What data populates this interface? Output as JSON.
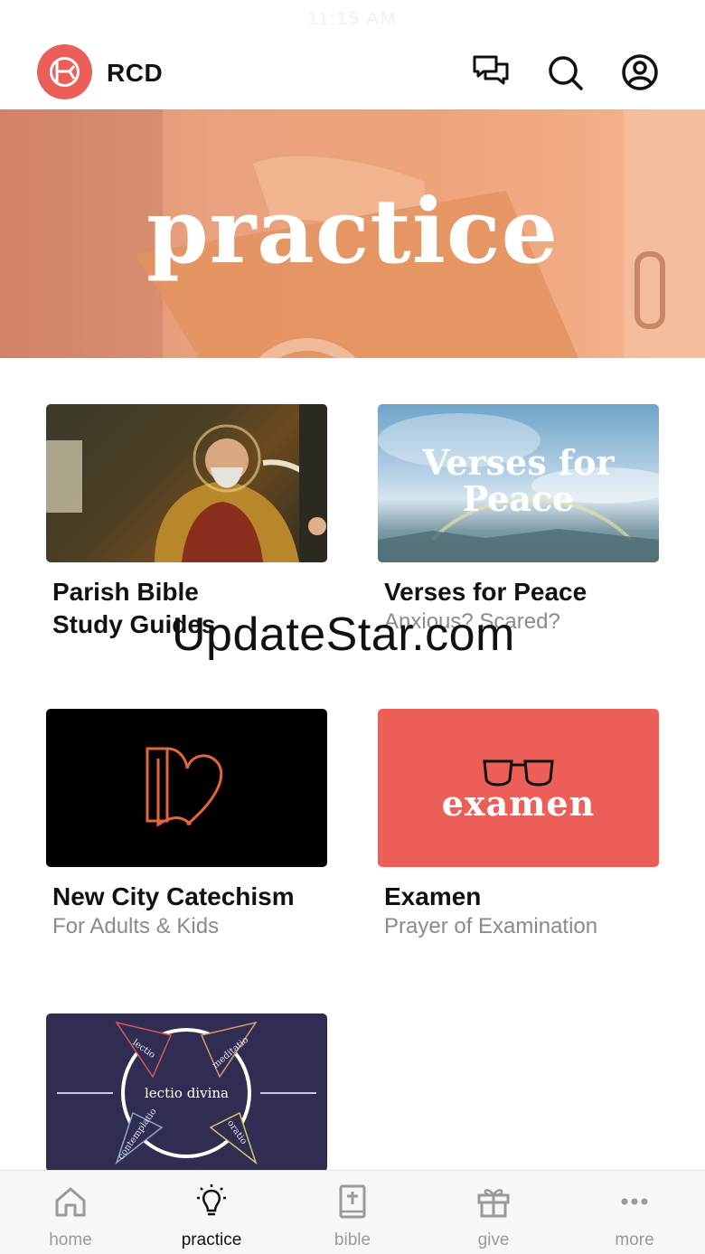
{
  "status_bar": {
    "time": "11:15 AM"
  },
  "header": {
    "app_name": "RCD",
    "icons": [
      "chat-icon",
      "search-icon",
      "profile-icon"
    ]
  },
  "hero": {
    "title": "practice"
  },
  "cards": [
    {
      "title": "Parish Bible Study Guides",
      "title_line1": "Parish Bible",
      "title_line2": "Study Guides",
      "subtitle": ""
    },
    {
      "title": "Verses for Peace",
      "subtitle": "Anxious? Scared?",
      "thumb_text_line1": "Verses for",
      "thumb_text_line2": "Peace"
    },
    {
      "title": "New City Catechism",
      "subtitle": "For Adults & Kids"
    },
    {
      "title": "Examen",
      "subtitle": "Prayer of Examination",
      "thumb_text": "examen"
    },
    {
      "title": "",
      "subtitle": "",
      "thumb_text": "lectio divina",
      "thumb_words": [
        "lectio",
        "meditatio",
        "contemplatio",
        "oratio"
      ]
    }
  ],
  "watermark": "UpdateStar.com",
  "tabs": [
    {
      "label": "home",
      "icon": "home-icon",
      "active": false
    },
    {
      "label": "practice",
      "icon": "lightbulb-icon",
      "active": true
    },
    {
      "label": "bible",
      "icon": "bible-icon",
      "active": false
    },
    {
      "label": "give",
      "icon": "gift-icon",
      "active": false
    },
    {
      "label": "more",
      "icon": "more-icon",
      "active": false
    }
  ],
  "colors": {
    "brand": "#ec5f58",
    "lectio_bg": "#2f2d52",
    "catechism_accent": "#e8643a"
  }
}
